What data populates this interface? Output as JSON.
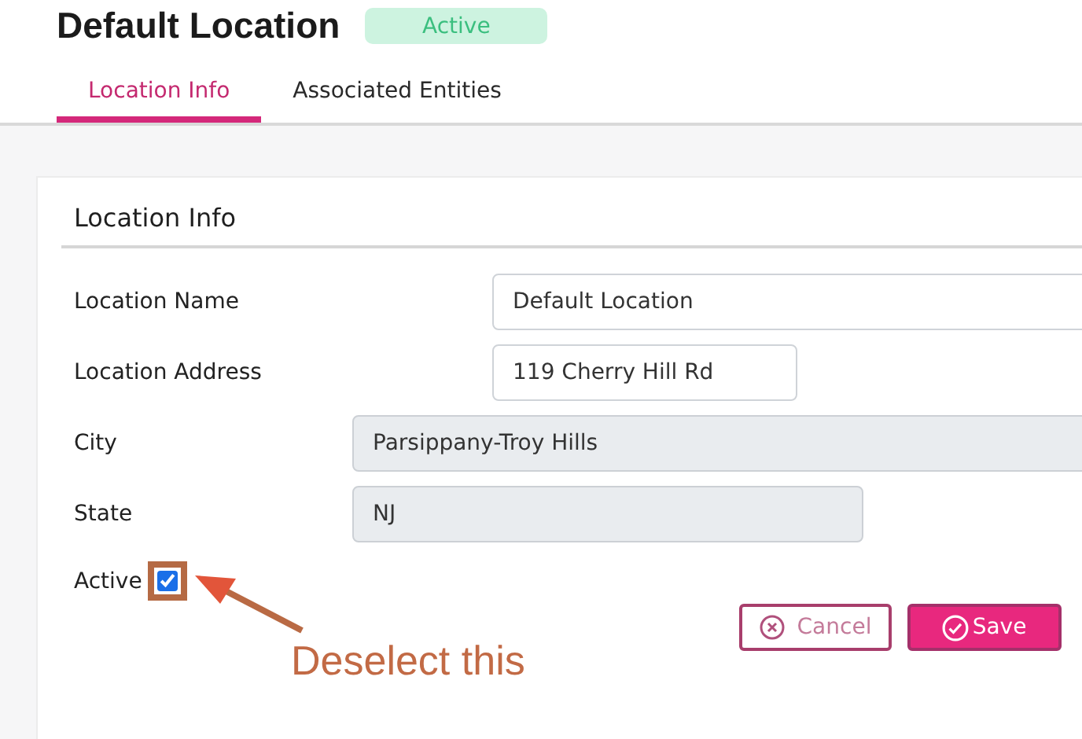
{
  "header": {
    "title": "Default Location",
    "status_badge": "Active"
  },
  "tabs": [
    {
      "label": "Location Info",
      "selected": true
    },
    {
      "label": "Associated Entities",
      "selected": false
    }
  ],
  "card": {
    "title": "Location Info",
    "fields": [
      {
        "label": "Location Name",
        "value": "Default Location",
        "disabled": false
      },
      {
        "label": "Location Address",
        "value": "119 Cherry Hill Rd",
        "disabled": false
      },
      {
        "label": "City",
        "value": "Parsippany-Troy Hills",
        "disabled": true
      },
      {
        "label": "State",
        "value": "NJ",
        "disabled": true
      }
    ],
    "active": {
      "label": "Active",
      "checked": true
    },
    "buttons": {
      "cancel": "Cancel",
      "save": "Save"
    }
  },
  "annotation": {
    "text": "Deselect this"
  }
}
